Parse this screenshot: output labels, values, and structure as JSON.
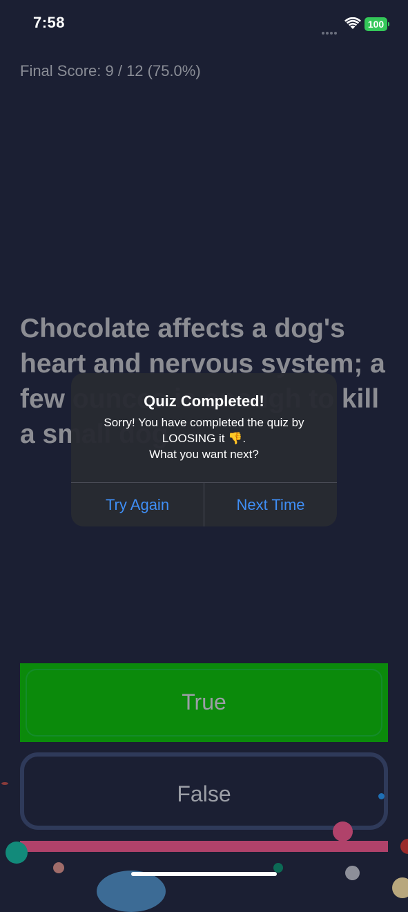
{
  "status_bar": {
    "time": "7:58",
    "battery": "100",
    "battery_color": "#34c759"
  },
  "score": {
    "text": "Final Score: 9 / 12 (75.0%)"
  },
  "question": {
    "text": "Chocolate affects a dog's heart and nervous system; a few ounces is enough to kill a small dog."
  },
  "answers": {
    "true_label": "True",
    "false_label": "False",
    "true_color": "#0b8a0b"
  },
  "progress": {
    "value": 1.0,
    "color": "#b0426a"
  },
  "alert": {
    "title": "Quiz Completed!",
    "message": "Sorry! You have completed the quiz by\nLOOSING it 👎.\nWhat you want next?",
    "buttons": [
      "Try Again",
      "Next Time"
    ],
    "button_color": "#3f8ef5"
  }
}
